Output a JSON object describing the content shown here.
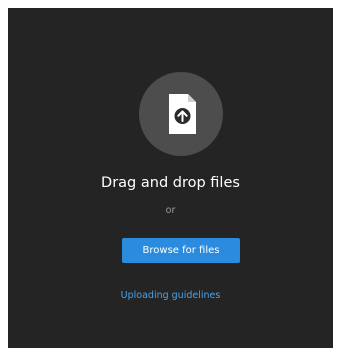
{
  "dropzone": {
    "icon": "file-upload-icon",
    "title": "Drag and drop files",
    "separator": "or",
    "browse_label": "Browse for files",
    "guidelines_label": "Uploading guidelines"
  },
  "colors": {
    "background": "#242424",
    "icon_circle": "#4d4d4d",
    "button": "#2b8cdf",
    "link": "#4aa3ea"
  }
}
